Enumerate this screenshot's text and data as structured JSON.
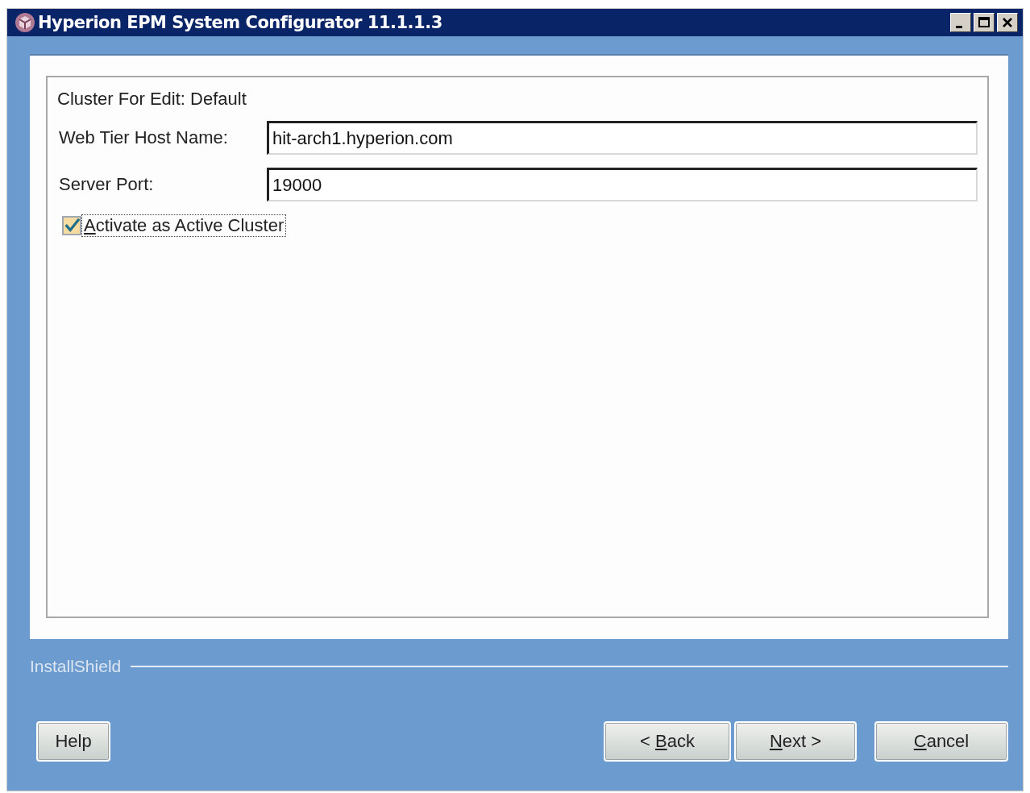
{
  "window": {
    "title": "Hyperion EPM System Configurator 11.1.1.3"
  },
  "form": {
    "heading": "Cluster For Edit: Default",
    "fields": [
      {
        "label": "Web Tier Host Name:",
        "value": "hit-arch1.hyperion.com"
      },
      {
        "label": "Server Port:",
        "value": "19000"
      }
    ],
    "checkbox": {
      "mnemonic": "A",
      "after": "ctivate as Active Cluster",
      "checked": true
    }
  },
  "brand": "InstallShield",
  "buttons": [
    {
      "before": "Help"
    },
    {
      "before": "< ",
      "mnemonic": "B",
      "after": "ack"
    },
    {
      "mnemonic": "N",
      "after": "ext >"
    },
    {
      "mnemonic": "C",
      "after": "ancel"
    }
  ]
}
